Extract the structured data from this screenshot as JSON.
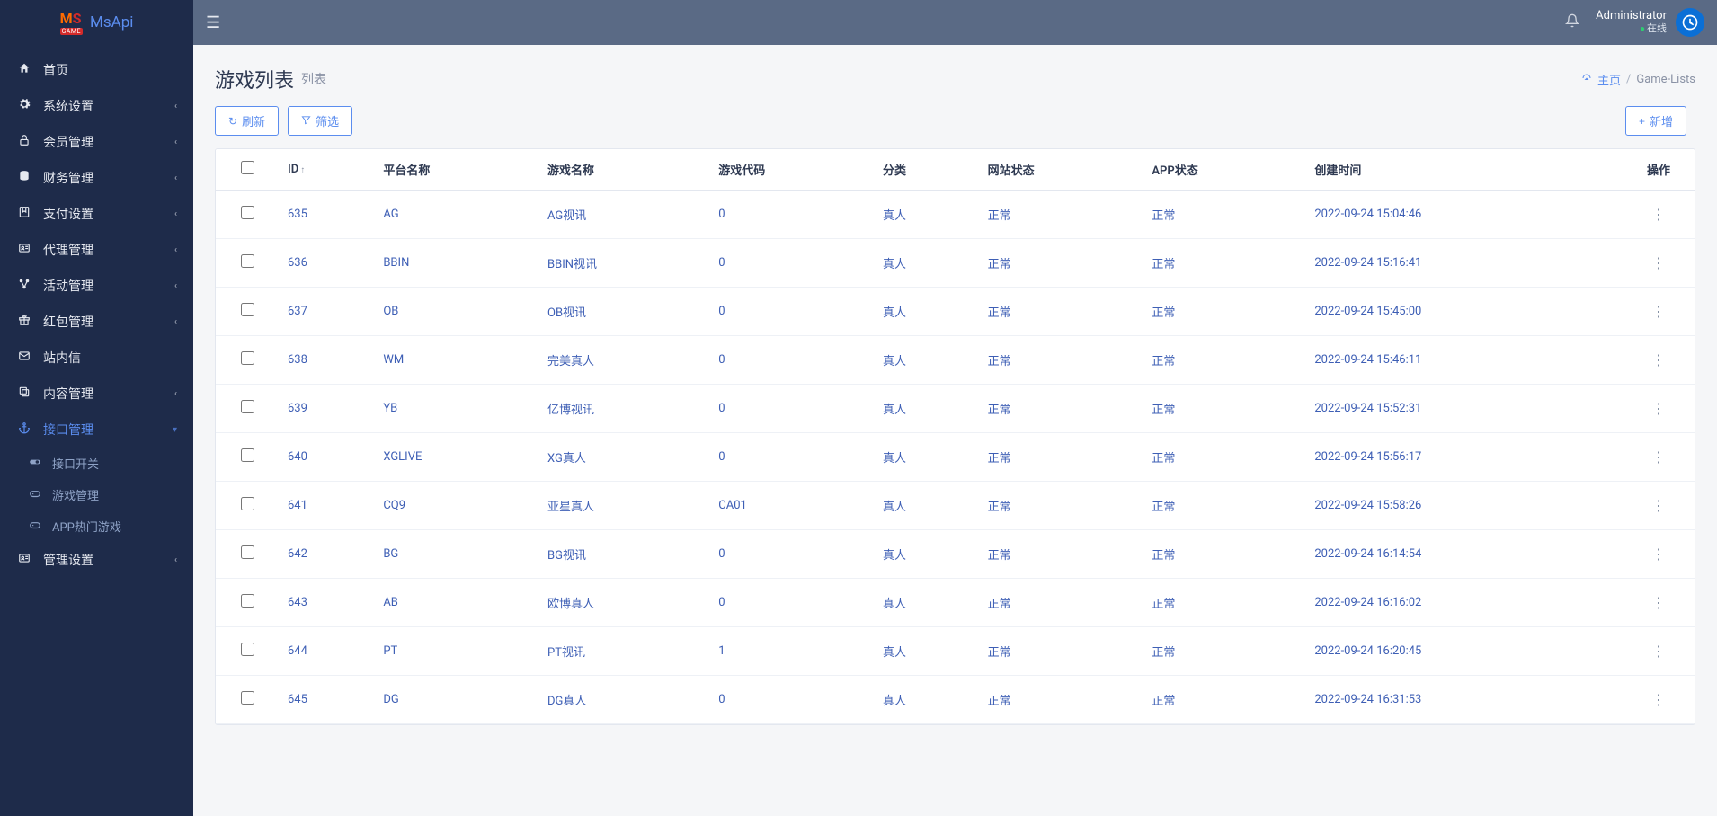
{
  "brand": {
    "name": "MsApi"
  },
  "topbar": {
    "username": "Administrator",
    "status": "在线"
  },
  "breadcrumb": {
    "home": "主页",
    "current": "Game-Lists"
  },
  "page": {
    "title": "游戏列表",
    "subtitle": "列表"
  },
  "toolbar": {
    "refresh": "刷新",
    "filter": "筛选",
    "add": "新增"
  },
  "sidebar": {
    "items": [
      {
        "icon": "home",
        "label": "首页",
        "chev": false
      },
      {
        "icon": "gears",
        "label": "系统设置",
        "chev": true
      },
      {
        "icon": "lock",
        "label": "会员管理",
        "chev": true
      },
      {
        "icon": "db",
        "label": "财务管理",
        "chev": true
      },
      {
        "icon": "bookmark",
        "label": "支付设置",
        "chev": true
      },
      {
        "icon": "idcard",
        "label": "代理管理",
        "chev": true
      },
      {
        "icon": "nodes",
        "label": "活动管理",
        "chev": true
      },
      {
        "icon": "gift",
        "label": "红包管理",
        "chev": true
      },
      {
        "icon": "mail",
        "label": "站内信",
        "chev": false
      },
      {
        "icon": "copy",
        "label": "内容管理",
        "chev": true
      },
      {
        "icon": "anchor",
        "label": "接口管理",
        "chev": true,
        "active": true,
        "expanded": true
      },
      {
        "icon": "idcard",
        "label": "管理设置",
        "chev": true
      }
    ],
    "subitems": [
      {
        "icon": "toggle",
        "label": "接口开关"
      },
      {
        "icon": "game",
        "label": "游戏管理"
      },
      {
        "icon": "game",
        "label": "APP热门游戏"
      }
    ]
  },
  "table": {
    "headers": {
      "id": "ID",
      "platform": "平台名称",
      "game": "游戏名称",
      "code": "游戏代码",
      "category": "分类",
      "webStatus": "网站状态",
      "appStatus": "APP状态",
      "created": "创建时间",
      "actions": "操作"
    },
    "rows": [
      {
        "id": "635",
        "platform": "AG",
        "game": "AG视讯",
        "code": "0",
        "category": "真人",
        "webStatus": "正常",
        "appStatus": "正常",
        "created": "2022-09-24 15:04:46"
      },
      {
        "id": "636",
        "platform": "BBIN",
        "game": "BBIN视讯",
        "code": "0",
        "category": "真人",
        "webStatus": "正常",
        "appStatus": "正常",
        "created": "2022-09-24 15:16:41"
      },
      {
        "id": "637",
        "platform": "OB",
        "game": "OB视讯",
        "code": "0",
        "category": "真人",
        "webStatus": "正常",
        "appStatus": "正常",
        "created": "2022-09-24 15:45:00"
      },
      {
        "id": "638",
        "platform": "WM",
        "game": "完美真人",
        "code": "0",
        "category": "真人",
        "webStatus": "正常",
        "appStatus": "正常",
        "created": "2022-09-24 15:46:11"
      },
      {
        "id": "639",
        "platform": "YB",
        "game": "亿博视讯",
        "code": "0",
        "category": "真人",
        "webStatus": "正常",
        "appStatus": "正常",
        "created": "2022-09-24 15:52:31"
      },
      {
        "id": "640",
        "platform": "XGLIVE",
        "game": "XG真人",
        "code": "0",
        "category": "真人",
        "webStatus": "正常",
        "appStatus": "正常",
        "created": "2022-09-24 15:56:17"
      },
      {
        "id": "641",
        "platform": "CQ9",
        "game": "亚星真人",
        "code": "CA01",
        "category": "真人",
        "webStatus": "正常",
        "appStatus": "正常",
        "created": "2022-09-24 15:58:26"
      },
      {
        "id": "642",
        "platform": "BG",
        "game": "BG视讯",
        "code": "0",
        "category": "真人",
        "webStatus": "正常",
        "appStatus": "正常",
        "created": "2022-09-24 16:14:54"
      },
      {
        "id": "643",
        "platform": "AB",
        "game": "欧博真人",
        "code": "0",
        "category": "真人",
        "webStatus": "正常",
        "appStatus": "正常",
        "created": "2022-09-24 16:16:02"
      },
      {
        "id": "644",
        "platform": "PT",
        "game": "PT视讯",
        "code": "1",
        "category": "真人",
        "webStatus": "正常",
        "appStatus": "正常",
        "created": "2022-09-24 16:20:45"
      },
      {
        "id": "645",
        "platform": "DG",
        "game": "DG真人",
        "code": "0",
        "category": "真人",
        "webStatus": "正常",
        "appStatus": "正常",
        "created": "2022-09-24 16:31:53"
      }
    ]
  }
}
